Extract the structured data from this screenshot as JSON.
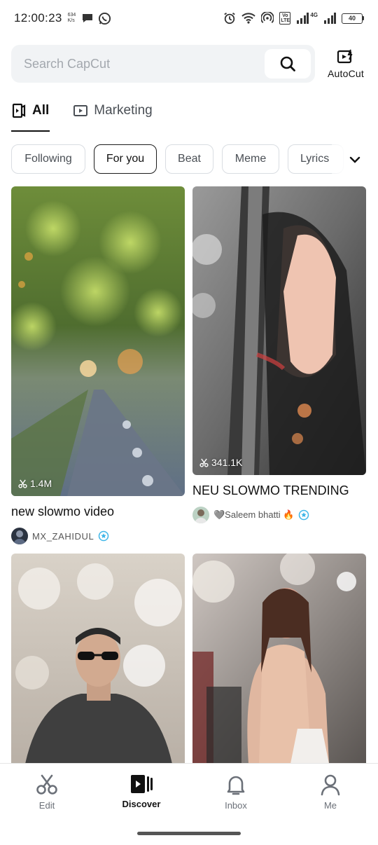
{
  "status_bar": {
    "time": "12:00:23",
    "net_speed_value": "634",
    "net_speed_unit": "K/s",
    "network_label": "4G",
    "volte_label": "Vo LTE",
    "battery": "40"
  },
  "search": {
    "placeholder": "Search CapCut"
  },
  "autocut_label": "AutoCut",
  "tabs": [
    {
      "label": "All",
      "active": true
    },
    {
      "label": "Marketing",
      "active": false
    }
  ],
  "chips": [
    {
      "label": "Following",
      "selected": false
    },
    {
      "label": "For you",
      "selected": true
    },
    {
      "label": "Beat",
      "selected": false
    },
    {
      "label": "Meme",
      "selected": false
    },
    {
      "label": "Lyrics",
      "selected": false
    }
  ],
  "templates": [
    {
      "title": "new slowmo video",
      "usage": "1.4M",
      "author": "MX_ZAHIDUL",
      "verified": true
    },
    {
      "title": "NEU SLOWMO TRENDING",
      "usage": "341.1K",
      "author": "🩶Saleem bhatti 🔥",
      "verified": true
    },
    {
      "title": "",
      "usage": "",
      "author": ""
    },
    {
      "title": "",
      "usage": "",
      "author": ""
    }
  ],
  "bottom_nav": [
    {
      "label": "Edit",
      "active": false
    },
    {
      "label": "Discover",
      "active": true
    },
    {
      "label": "Inbox",
      "active": false
    },
    {
      "label": "Me",
      "active": false
    }
  ],
  "colors": {
    "accent": "#111111",
    "search_bg": "#f1f3f5",
    "verified": "#3fb6e8"
  }
}
